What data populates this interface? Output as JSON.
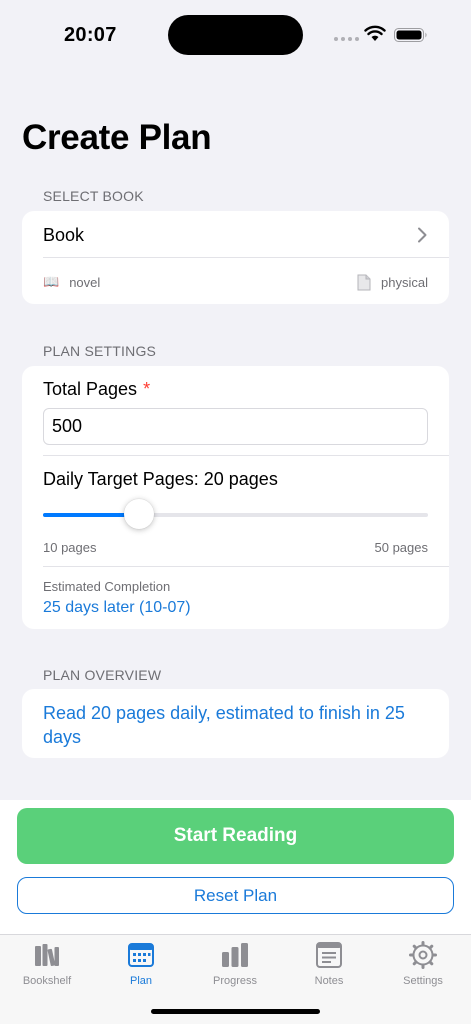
{
  "status_bar": {
    "time": "20:07"
  },
  "page_title": "Create Plan",
  "select_book": {
    "section_label": "SELECT BOOK",
    "book_label": "Book",
    "genre": "novel",
    "format": "physical"
  },
  "plan_settings": {
    "section_label": "PLAN SETTINGS",
    "total_pages_label": "Total Pages",
    "required_mark": "*",
    "total_pages_value": "500",
    "daily_target_label": "Daily Target Pages: 20 pages",
    "slider": {
      "min": 10,
      "max": 50,
      "value": 20
    },
    "min_label": "10 pages",
    "max_label": "50 pages",
    "estimated_label": "Estimated Completion",
    "estimated_value": "25 days later (10-07)"
  },
  "plan_overview": {
    "section_label": "PLAN OVERVIEW",
    "text": "Read 20 pages daily, estimated to finish in 25 days"
  },
  "actions": {
    "start_label": "Start Reading",
    "reset_label": "Reset Plan"
  },
  "tabs": [
    {
      "label": "Bookshelf",
      "icon": "books-icon",
      "active": false
    },
    {
      "label": "Plan",
      "icon": "calendar-icon",
      "active": true
    },
    {
      "label": "Progress",
      "icon": "bar-chart-icon",
      "active": false
    },
    {
      "label": "Notes",
      "icon": "notes-icon",
      "active": false
    },
    {
      "label": "Settings",
      "icon": "gear-icon",
      "active": false
    }
  ],
  "colors": {
    "accent": "#1a7ad9",
    "start_button": "#5ad07a",
    "required": "#ff3b30",
    "background": "#f2f2f7"
  }
}
